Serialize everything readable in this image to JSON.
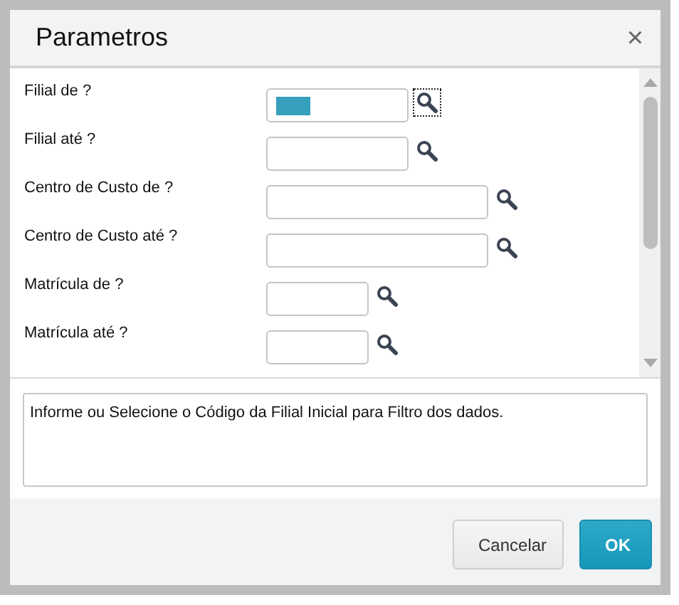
{
  "dialog": {
    "title": "Parametros",
    "close": "×"
  },
  "parameters": [
    {
      "label": "Filial de ?",
      "kind": "medium",
      "focused": true
    },
    {
      "label": "Filial até ?",
      "kind": "medium",
      "focused": false
    },
    {
      "label": "Centro de Custo de ?",
      "kind": "long",
      "focused": false
    },
    {
      "label": "Centro de Custo até ?",
      "kind": "long",
      "focused": false
    },
    {
      "label": "Matrícula de ?",
      "kind": "short",
      "focused": false
    },
    {
      "label": "Matrícula até ?",
      "kind": "short",
      "focused": false
    }
  ],
  "help_text": "Informe ou Selecione o Código da Filial Inicial para Filtro dos dados.",
  "buttons": [
    {
      "label": "Cancelar",
      "kind": "secondary"
    },
    {
      "label": "OK",
      "kind": "primary"
    }
  ]
}
